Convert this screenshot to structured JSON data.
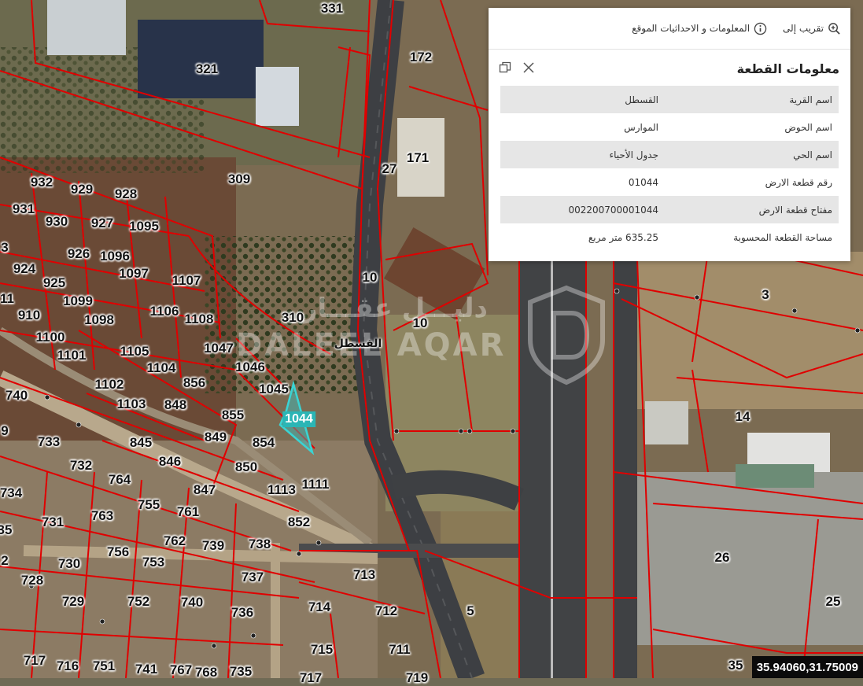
{
  "panel": {
    "toolbar": {
      "zoom_label": "تقريب إلى",
      "info_label": "المعلومات و الاحداثيات الموقع"
    },
    "title": "معلومات القطعة",
    "rows": [
      {
        "key": "اسم القرية",
        "value": "القسطل"
      },
      {
        "key": "اسم الحوض",
        "value": "الموارس"
      },
      {
        "key": "اسم الحي",
        "value": "جدول الأحياء"
      },
      {
        "key": "رقم قطعة الارض",
        "value": "01044"
      },
      {
        "key": "مفتاح قطعة الارض",
        "value": "002200700001044"
      },
      {
        "key": "مساحة القطعة المحسوبة",
        "value": "635.25 متر مربع"
      }
    ]
  },
  "map": {
    "place_name": "القسطل",
    "selected_parcel": "1044",
    "coordinates": "35.94060,31.75009",
    "watermark_ar": "دليـــل عقـــار",
    "watermark_en": "DALEEL AQAR",
    "colors": {
      "parcel_border": "#e00000",
      "selected_fill": "#39c6c6",
      "panel_bg": "#ffffff"
    },
    "parcel_labels": [
      "331",
      "172",
      "321",
      "171",
      "27",
      "932",
      "929",
      "928",
      "931",
      "930",
      "927",
      "1095",
      "309",
      "3",
      "926",
      "1096",
      "924",
      "1097",
      "925",
      "1107",
      "11",
      "1099",
      "910",
      "1098",
      "1106",
      "1108",
      "310",
      "10",
      "1100",
      "1105",
      "1047",
      "1101",
      "1104",
      "1046",
      "740",
      "856",
      "1102",
      "1045",
      "1103",
      "848",
      "855",
      "9",
      "733",
      "849",
      "854",
      "845",
      "846",
      "850",
      "732",
      "764",
      "734",
      "847",
      "1113",
      "1111",
      "755",
      "761",
      "763",
      "731",
      "852",
      "35",
      "762",
      "739",
      "738",
      "756",
      "753",
      "2",
      "730",
      "737",
      "728",
      "713",
      "752",
      "740",
      "729",
      "736",
      "714",
      "712",
      "5",
      "715",
      "711",
      "717",
      "716",
      "751",
      "741",
      "767",
      "768",
      "735",
      "3",
      "14",
      "26",
      "25",
      "35",
      "10",
      "717",
      "719"
    ]
  }
}
